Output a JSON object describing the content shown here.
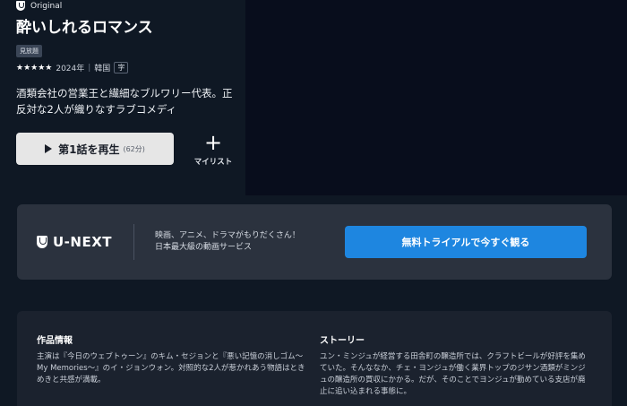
{
  "header": {
    "brand_label": "Original",
    "title": "酔いしれるロマンス",
    "badge": "見放題",
    "stars": "★★★★★",
    "year": "2024年",
    "country": "韓国",
    "subtitle_badge": "字",
    "description": "酒類会社の営業王と繊細なブルワリー代表。正反対な2人が織りなすラブコメディ"
  },
  "actions": {
    "play_label": "第1話を再生",
    "play_duration": "(62分)",
    "mylist_label": "マイリスト"
  },
  "promo": {
    "logo_text": "U-NEXT",
    "copy_line1": "映画、アニメ、ドラマがもりだくさん！",
    "copy_line2": "日本最大級の動画サービス",
    "trial_button": "無料トライアルで今すぐ観る"
  },
  "info": {
    "work_heading": "作品情報",
    "work_text": "主演は『今日のウェブトゥーン』のキム・セジョンと『悪い記憶の消しゴム〜My Memories〜』のイ・ジョンウォン。対照的な2人が惹かれあう物語はときめきと共感が満載。",
    "story_heading": "ストーリー",
    "story_text": "ユン・ミンジュが経営する田舎町の醸造所では、クラフトビールが好評を集めていた。そんななか、チェ・ヨンジュが働く業界トップのジサン酒類がミンジュの醸造所の買収にかかる。だが、そのことでヨンジュが勤めている支店が廃止に追い込まれる事態に。"
  },
  "colors": {
    "background": "#0f1824",
    "hero_dark": "#080d1c",
    "accent_blue": "#1e86e0"
  }
}
